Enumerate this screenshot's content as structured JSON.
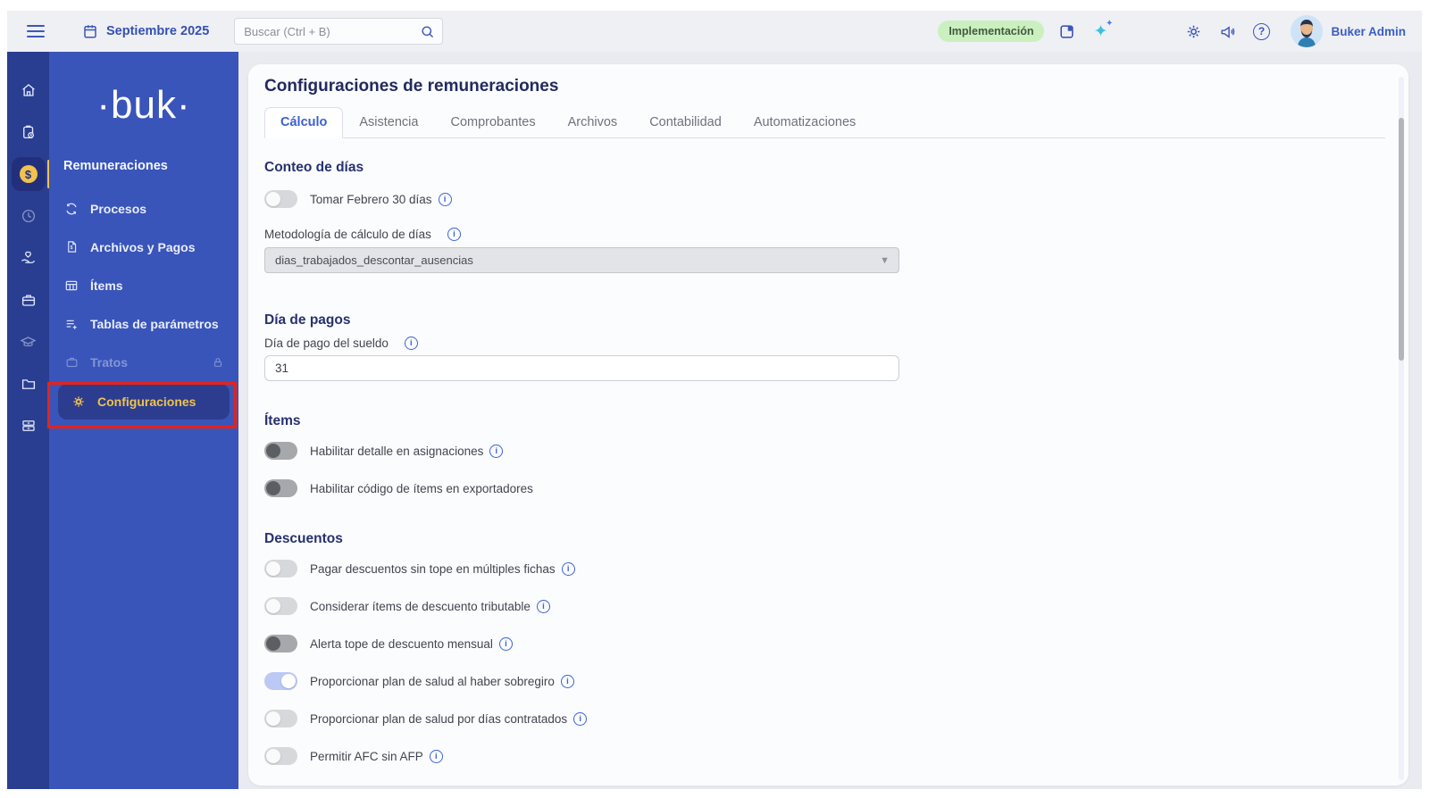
{
  "colors": {
    "sidebar_blue": "#3a55b9",
    "rail_blue": "#293e91",
    "accent_yellow": "#f0c24f",
    "annotation_red": "#e5231b",
    "badge_green_bg": "#cbf0bf",
    "link_blue": "#3b5ec4",
    "toggle_on": "#bcc9f4",
    "heading_navy": "#27316e"
  },
  "topbar": {
    "month": "Septiembre 2025",
    "search_placeholder": "Buscar (Ctrl + B)",
    "badge": "Implementación",
    "user": "Buker Admin",
    "icons": [
      "hamburger-icon",
      "calendar-icon",
      "search-icon",
      "bookmark-icon",
      "sparkle-icon",
      "gear-icon",
      "megaphone-icon",
      "help-icon",
      "avatar"
    ]
  },
  "sidebar": {
    "logo": "·buk·",
    "section": "Remuneraciones",
    "rail_icons": [
      "home-icon",
      "clipboard-clock-icon",
      "payroll-coin-icon",
      "clock-icon",
      "hand-heart-icon",
      "briefcase-icon",
      "graduation-cap-icon",
      "folder-icon",
      "drawers-icon"
    ],
    "rail_active": "payroll-coin-icon",
    "items": [
      {
        "label": "Procesos",
        "icon": "refresh-icon",
        "state": "normal"
      },
      {
        "label": "Archivos y Pagos",
        "icon": "file-icon",
        "state": "normal"
      },
      {
        "label": "Ítems",
        "icon": "table-icon",
        "state": "normal"
      },
      {
        "label": "Tablas de parámetros",
        "icon": "list-plus-icon",
        "state": "normal"
      },
      {
        "label": "Tratos",
        "icon": "briefcase-icon",
        "state": "locked"
      },
      {
        "label": "Configuraciones",
        "icon": "gear-icon",
        "state": "active-highlighted-red"
      }
    ]
  },
  "main": {
    "title": "Configuraciones de remuneraciones",
    "tabs": [
      "Cálculo",
      "Asistencia",
      "Comprobantes",
      "Archivos",
      "Contabilidad",
      "Automatizaciones"
    ],
    "active_tab": "Cálculo",
    "sections": [
      {
        "heading": "Conteo de días",
        "toggles": [
          {
            "label": "Tomar Febrero 30 días",
            "state": "off",
            "style": "light",
            "info": true
          }
        ],
        "field": {
          "label": "Metodología de cálculo de días",
          "info": true,
          "type": "select-disabled",
          "value": "dias_trabajados_descontar_ausencias"
        }
      },
      {
        "heading": "Día de pagos",
        "field": {
          "label": "Día de pago del sueldo",
          "info": true,
          "type": "text-input",
          "value": "31"
        }
      },
      {
        "heading": "Ítems",
        "toggles": [
          {
            "label": "Habilitar detalle en asignaciones",
            "state": "off",
            "style": "dark",
            "info": true
          },
          {
            "label": "Habilitar código de ítems en exportadores",
            "state": "off",
            "style": "dark",
            "info": false
          }
        ]
      },
      {
        "heading": "Descuentos",
        "toggles": [
          {
            "label": "Pagar descuentos sin tope en múltiples fichas",
            "state": "off",
            "style": "light",
            "info": true
          },
          {
            "label": "Considerar ítems de descuento tributable",
            "state": "off",
            "style": "light",
            "info": true
          },
          {
            "label": "Alerta tope de descuento mensual",
            "state": "off",
            "style": "dark",
            "info": true
          },
          {
            "label": "Proporcionar plan de salud al haber sobregiro",
            "state": "on",
            "style": "on",
            "info": true
          },
          {
            "label": "Proporcionar plan de salud por días contratados",
            "state": "off",
            "style": "light",
            "info": true
          },
          {
            "label": "Permitir AFC sin AFP",
            "state": "off",
            "style": "light",
            "info": true
          }
        ]
      }
    ]
  }
}
